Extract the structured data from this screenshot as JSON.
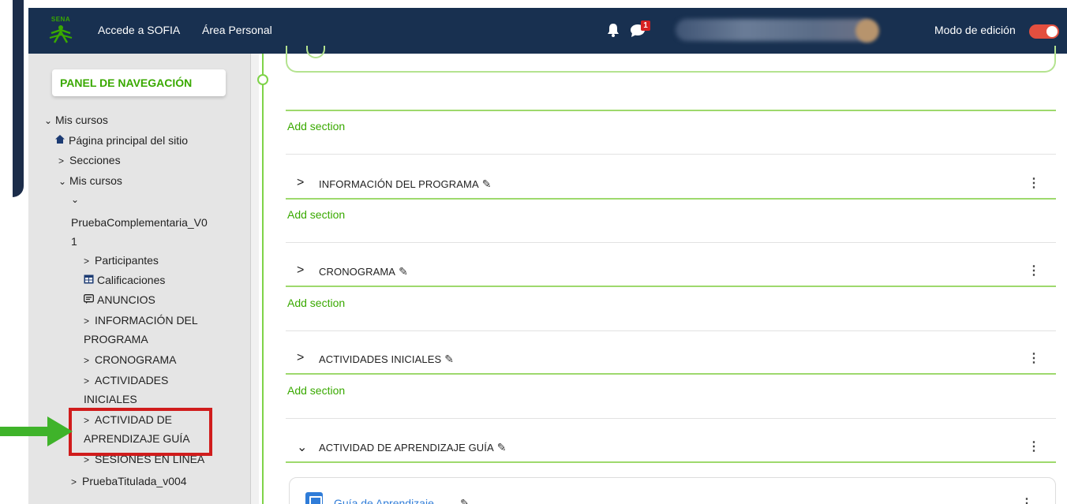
{
  "header": {
    "logo_text": "SENA",
    "links": [
      "Accede a SOFIA",
      "Área Personal"
    ],
    "notification_count": "1",
    "edit_mode_label": "Modo de edición",
    "edit_mode_on": true
  },
  "sidebar": {
    "panel_button": "PANEL DE NAVEGACIÓN",
    "items": [
      {
        "label": "Mis cursos",
        "expanded": true
      },
      {
        "label": "Página principal del sitio",
        "icon": "home-icon"
      },
      {
        "label": "Secciones",
        "expanded": false
      },
      {
        "label": "Mis cursos",
        "expanded": true
      },
      {
        "label": "PruebaComplementaria_V0",
        "label_cont": "1",
        "expanded": true
      },
      {
        "label": "Participantes",
        "expanded": false
      },
      {
        "label": "Calificaciones",
        "icon": "table-icon"
      },
      {
        "label": "ANUNCIOS",
        "icon": "forum-icon"
      },
      {
        "label": "INFORMACIÓN DEL",
        "label_cont": "PROGRAMA",
        "expanded": false
      },
      {
        "label": "CRONOGRAMA",
        "expanded": false
      },
      {
        "label": "ACTIVIDADES",
        "label_cont": "INICIALES",
        "expanded": false
      },
      {
        "label": "ACTIVIDAD DE",
        "label_cont": "APRENDIZAJE GUÍA",
        "expanded": false
      },
      {
        "label": "SESIONES EN LÍNEA",
        "expanded": false
      },
      {
        "label": "PruebaTitulada_v004",
        "expanded": false
      }
    ]
  },
  "main": {
    "add_section_label": "Add section",
    "sections": [
      {
        "title": "INFORMACIÓN DEL PROGRAMA",
        "expanded": false
      },
      {
        "title": "CRONOGRAMA",
        "expanded": false
      },
      {
        "title": "ACTIVIDADES INICIALES",
        "expanded": false
      },
      {
        "title": "ACTIVIDAD DE APRENDIZAJE GUÍA",
        "expanded": true
      }
    ],
    "activity": {
      "title": "Guía de Aprendizaje"
    }
  },
  "colors": {
    "topbar": "#183050",
    "accent_green": "#39a900",
    "highlight_red": "#d01c1c",
    "arrow_green": "#3fb32a",
    "toggle_on": "#e34f3f"
  }
}
